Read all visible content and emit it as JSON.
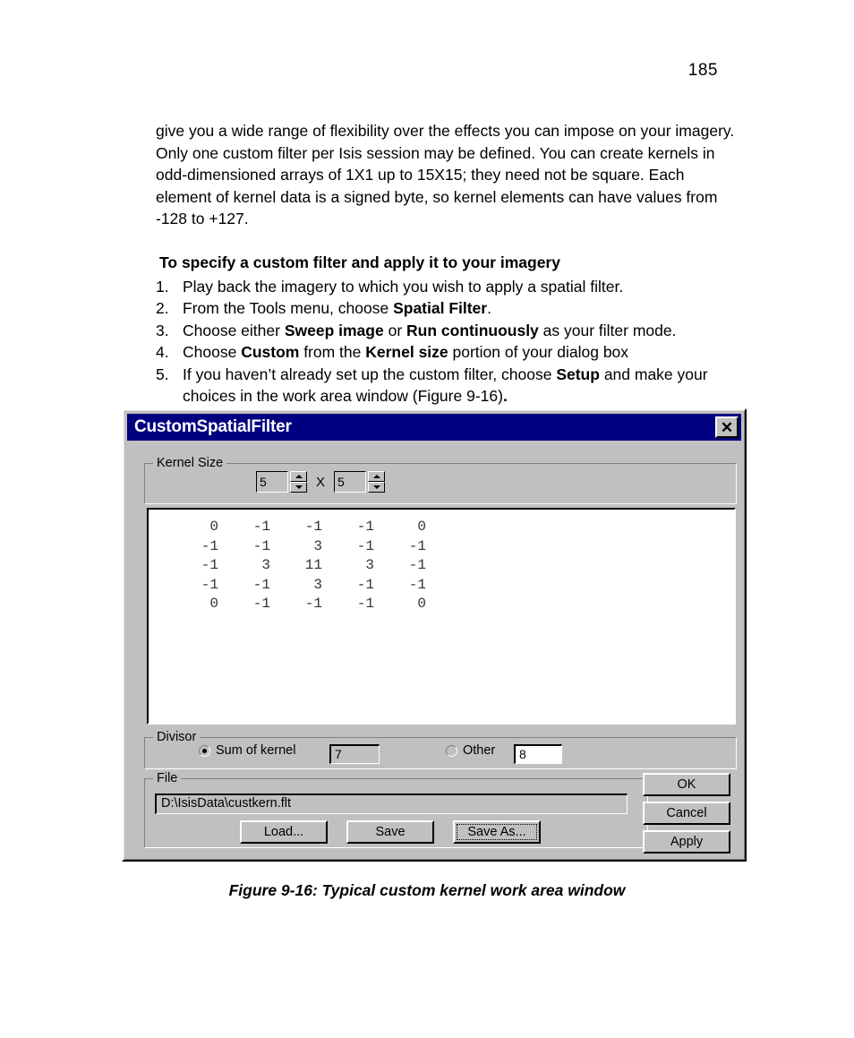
{
  "page": {
    "number": "185",
    "paragraph": "give you a wide range of flexibility over the effects you can impose on your imagery. Only one custom filter per Isis session may be defined. You can create kernels in odd-dimensioned arrays of 1X1 up to 15X15; they need not be square. Each element of kernel data is a signed byte, so kernel elements can have values from -128 to +127.",
    "procedure_heading": "To specify a custom filter and apply it to your imagery",
    "steps": [
      {
        "num": "1.",
        "text": "Play back the imagery to which you wish to apply a spatial filter."
      },
      {
        "num": "2.",
        "text": "From the Tools menu, choose <b>Spatial Filter</b>."
      },
      {
        "num": "3.",
        "text": "Choose either <b>Sweep image</b> or <b>Run continuously</b> as your filter mode."
      },
      {
        "num": "4.",
        "text": "Choose <b>Custom</b> from the <b>Kernel size</b> portion of your dialog box"
      },
      {
        "num": "5.",
        "text": "If you haven&rsquo;t already set up the custom filter, choose <b>Setup</b> and make your choices in the work area window (Figure 9-16)<b>.</b>"
      }
    ],
    "figure_caption": "Figure 9-16: Typical custom kernel work area window"
  },
  "dialog": {
    "title": "CustomSpatialFilter",
    "close_label": "✕",
    "kernel_size": {
      "group_label": "Kernel Size",
      "width_value": "5",
      "height_value": "5",
      "separator": "X"
    },
    "kernel_matrix": {
      "rows": [
        [
          "0",
          "-1",
          "-1",
          "-1",
          "0"
        ],
        [
          "-1",
          "-1",
          "3",
          "-1",
          "-1"
        ],
        [
          "-1",
          "3",
          "11",
          "3",
          "-1"
        ],
        [
          "-1",
          "-1",
          "3",
          "-1",
          "-1"
        ],
        [
          "0",
          "-1",
          "-1",
          "-1",
          "0"
        ]
      ]
    },
    "divisor": {
      "group_label": "Divisor",
      "sum_label": "Sum of kernel",
      "sum_value": "7",
      "sum_selected": true,
      "other_label": "Other",
      "other_value": "8",
      "other_selected": false
    },
    "file": {
      "group_label": "File",
      "path": "D:\\IsisData\\custkern.flt",
      "load_label": "Load...",
      "save_label": "Save",
      "save_as_label": "Save As..."
    },
    "actions": {
      "ok_label": "OK",
      "cancel_label": "Cancel",
      "apply_label": "Apply"
    },
    "colors": {
      "titlebar": "#000080",
      "face": "#c0c0c0",
      "field": "#ffffff",
      "text": "#000000"
    }
  }
}
